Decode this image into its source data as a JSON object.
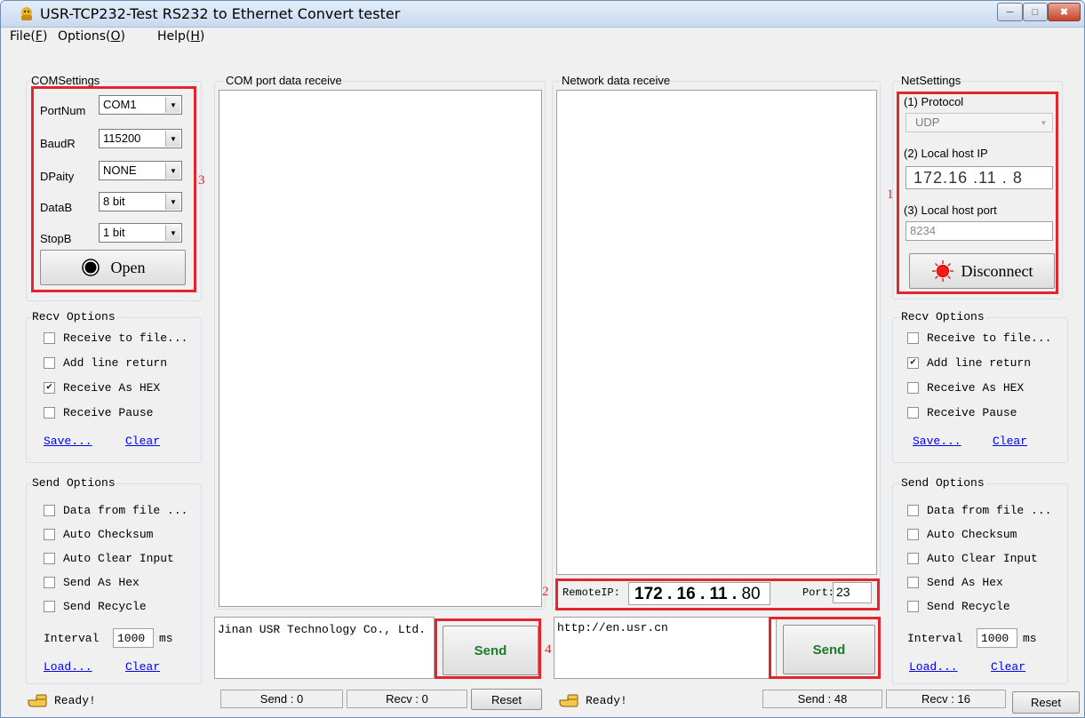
{
  "window": {
    "title": "USR-TCP232-Test  RS232 to Ethernet Convert tester"
  },
  "menu": {
    "file": {
      "text": "File(",
      "hotkey": "F",
      "close": ")"
    },
    "options": {
      "text": "Options(",
      "hotkey": "O",
      "close": ")"
    },
    "help": {
      "text": "Help(",
      "hotkey": "H",
      "close": ")"
    }
  },
  "com_settings": {
    "legend": "COMSettings",
    "port_label": "PortNum",
    "port_value": "COM1",
    "baud_label": "BaudR",
    "baud_value": "115200",
    "parity_label": "DPaity",
    "parity_value": "NONE",
    "databits_label": "DataB",
    "databits_value": "8 bit",
    "stopbits_label": "StopB",
    "stopbits_value": "1 bit",
    "open_label": "Open"
  },
  "com_receive": {
    "legend": "COM port data receive"
  },
  "net_receive": {
    "legend": "Network data receive"
  },
  "net_settings": {
    "legend": "NetSettings",
    "protocol_label": "(1) Protocol",
    "protocol_value": "UDP",
    "local_ip_label": "(2) Local host IP",
    "ip_1": "172",
    "ip_2": "16",
    "ip_3": "11",
    "ip_4": "8",
    "local_port_label": "(3) Local host port",
    "local_port_value": "8234",
    "disconnect_label": "Disconnect"
  },
  "left_recv_options": {
    "legend": "Recv Options",
    "items": [
      {
        "label": "Receive to file...",
        "checked": false
      },
      {
        "label": "Add line return",
        "checked": false
      },
      {
        "label": "Receive As HEX",
        "checked": true
      },
      {
        "label": "Receive Pause",
        "checked": false
      }
    ],
    "save": "Save...",
    "clear": "Clear"
  },
  "right_recv_options": {
    "legend": "Recv Options",
    "items": [
      {
        "label": "Receive to file...",
        "checked": false
      },
      {
        "label": "Add line return",
        "checked": true
      },
      {
        "label": "Receive As HEX",
        "checked": false
      },
      {
        "label": "Receive Pause",
        "checked": false
      }
    ],
    "save": "Save...",
    "clear": "Clear"
  },
  "left_send_options": {
    "legend": "Send Options",
    "items": [
      {
        "label": "Data from file ...",
        "checked": false
      },
      {
        "label": "Auto Checksum",
        "checked": false
      },
      {
        "label": "Auto Clear Input",
        "checked": false
      },
      {
        "label": "Send As Hex",
        "checked": false
      },
      {
        "label": "Send Recycle",
        "checked": false
      }
    ],
    "interval_label": "Interval",
    "interval_value": "1000",
    "interval_unit": "ms",
    "load": "Load...",
    "clear": "Clear"
  },
  "right_send_options": {
    "legend": "Send Options",
    "items": [
      {
        "label": "Data from file ...",
        "checked": false
      },
      {
        "label": "Auto Checksum",
        "checked": false
      },
      {
        "label": "Auto Clear Input",
        "checked": false
      },
      {
        "label": "Send As Hex",
        "checked": false
      },
      {
        "label": "Send Recycle",
        "checked": false
      }
    ],
    "interval_label": "Interval",
    "interval_value": "1000",
    "interval_unit": "ms",
    "load": "Load...",
    "clear": "Clear"
  },
  "remote": {
    "ip_label": "RemoteIP:",
    "ip_1": "172",
    "ip_2": "16",
    "ip_3": "11",
    "ip_4": "80",
    "port_label": "Port:",
    "port_value": "23"
  },
  "com_send": {
    "text": "Jinan USR Technology Co., Ltd.",
    "send_label": "Send"
  },
  "net_send": {
    "text": "http://en.usr.cn",
    "send_label": "Send"
  },
  "status": {
    "left_ready": "Ready!",
    "com_send": "Send : 0",
    "com_recv": "Recv : 0",
    "com_reset": "Reset",
    "right_ready": "Ready!",
    "net_send": "Send : 48",
    "net_recv": "Recv : 16",
    "net_reset": "Reset"
  },
  "annotations": {
    "n1": "1",
    "n2": "2",
    "n3": "3",
    "n4": "4"
  },
  "colors": {
    "annotation_red": "#e3262d",
    "send_text_green": "#1f7a2a",
    "link_blue": "#0000ee"
  }
}
